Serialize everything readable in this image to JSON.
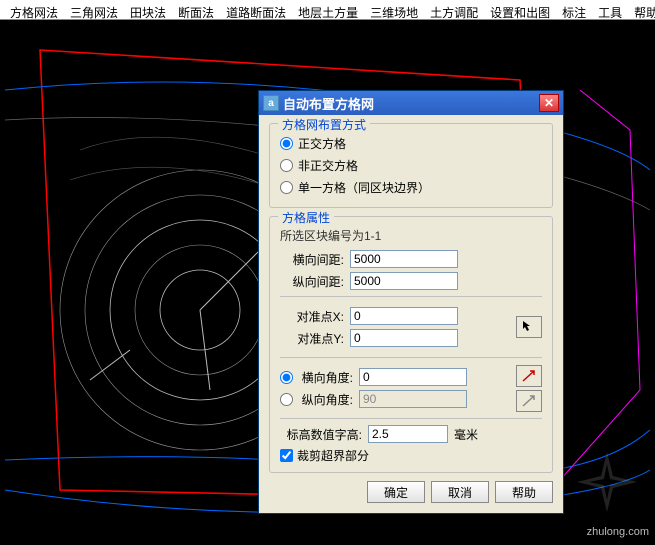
{
  "menu": [
    "方格网法",
    "三角网法",
    "田块法",
    "断面法",
    "道路断面法",
    "地层土方量",
    "三维场地",
    "土方调配",
    "设置和出图",
    "标注",
    "工具",
    "帮助"
  ],
  "dialog": {
    "title": "自动布置方格网",
    "group1": {
      "title": "方格网布置方式",
      "r1": "正交方格",
      "r2": "非正交方格",
      "r3": "单一方格（同区块边界）"
    },
    "group2": {
      "title": "方格属性",
      "info": "所选区块编号为1-1",
      "hspacing_label": "横向间距:",
      "hspacing": "5000",
      "vspacing_label": "纵向间距:",
      "vspacing": "5000",
      "px_label": "对准点X:",
      "px": "0",
      "py_label": "对准点Y:",
      "py": "0",
      "ha_label": "横向角度:",
      "ha": "0",
      "va_label": "纵向角度:",
      "va": "90",
      "th_label": "标高数值字高:",
      "th": "2.5",
      "th_unit": "毫米",
      "clip": "裁剪超界部分"
    },
    "ok": "确定",
    "cancel": "取消",
    "help": "帮助"
  },
  "watermark": "zhulong.com"
}
